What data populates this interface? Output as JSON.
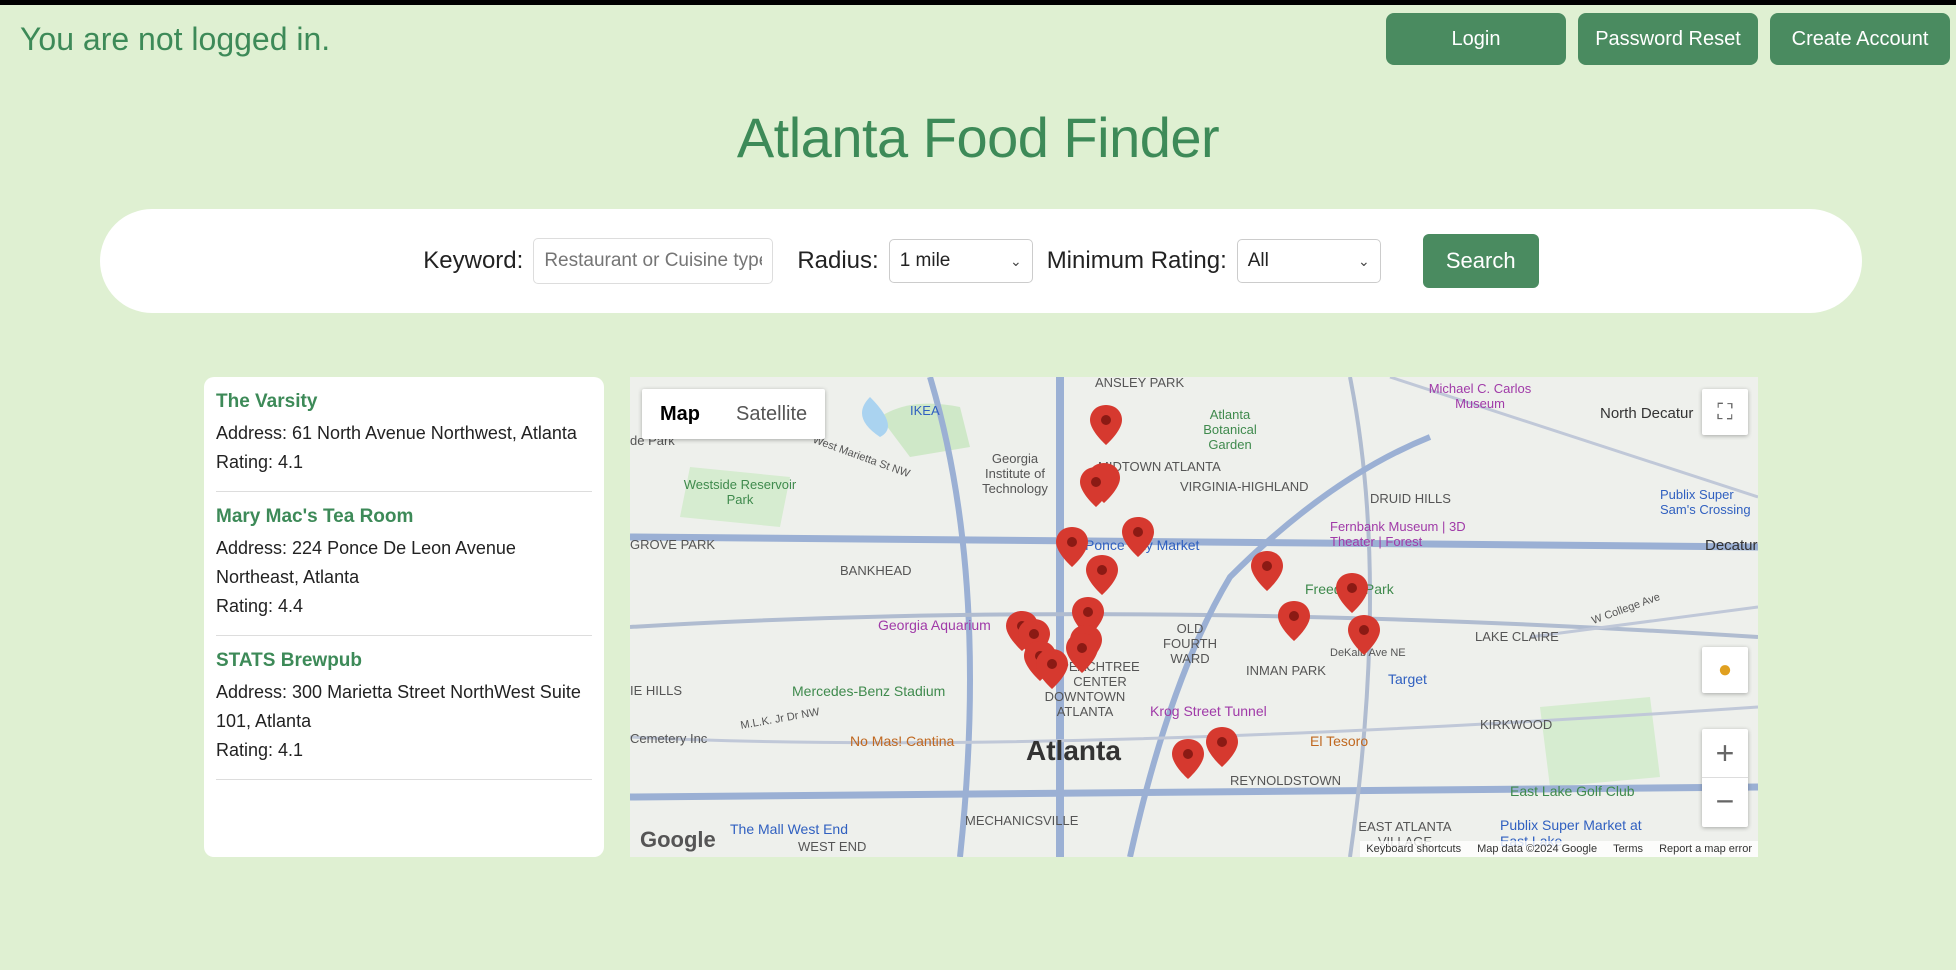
{
  "status": "You are not logged in.",
  "auth": {
    "login": "Login",
    "reset": "Password Reset",
    "create": "Create Account"
  },
  "title": "Atlanta Food Finder",
  "search": {
    "keyword_label": "Keyword:",
    "keyword_placeholder": "Restaurant or Cuisine type",
    "radius_label": "Radius:",
    "radius_value": "1 mile",
    "rating_label": "Minimum Rating:",
    "rating_value": "All",
    "button": "Search"
  },
  "results": [
    {
      "name": "The Varsity",
      "address": "Address: 61 North Avenue Northwest, Atlanta",
      "rating": "Rating: 4.1"
    },
    {
      "name": "Mary Mac's Tea Room",
      "address": "Address: 224 Ponce De Leon Avenue Northeast, Atlanta",
      "rating": "Rating: 4.4"
    },
    {
      "name": "STATS Brewpub",
      "address": "Address: 300 Marietta Street NorthWest Suite 101, Atlanta",
      "rating": "Rating: 4.1"
    }
  ],
  "map": {
    "type_map": "Map",
    "type_satellite": "Satellite",
    "city_label": "Atlanta",
    "google": "Google",
    "attribution": [
      "Keyboard shortcuts",
      "Map data ©2024 Google",
      "Terms",
      "Report a map error"
    ],
    "labels": [
      "ANSLEY PARK",
      "Atlanta Botanical Garden",
      "Michael C. Carlos Museum",
      "North Decatur",
      "IKEA",
      "Georgia Institute of Technology",
      "MIDTOWN ATLANTA",
      "VIRGINIA-HIGHLAND",
      "DRUID HILLS",
      "Westside Reservoir Park",
      "Publix Super Sam's Crossing",
      "Fernbank Museum | 3D Theater | Forest",
      "GROVE PARK",
      "Ponce City Market",
      "Decatur",
      "BANKHEAD",
      "Freedom Park",
      "Georgia Aquarium",
      "OLD FOURTH WARD",
      "LAKE CLAIRE",
      "PEACHTREE CENTER",
      "INMAN PARK",
      "Target",
      "Mercedes-Benz Stadium",
      "DOWNTOWN ATLANTA",
      "Krog Street Tunnel",
      "KIRKWOOD",
      "Cemetery Inc",
      "No Mas! Cantina",
      "El Tesoro",
      "REYNOLDSTOWN",
      "East Lake Golf Club",
      "The Mall West End",
      "MECHANICSVILLE",
      "EAST ATLANTA VILLAGE",
      "Publix Super Market at East Lake",
      "WEST END",
      "de Park",
      "West Marietta St NW",
      "M.L.K. Jr Dr NW",
      "DeKalb Ave NE",
      "W College Ave",
      "IE HILLS"
    ]
  },
  "colors": {
    "bg": "#dff0d2",
    "accent": "#4a8b60",
    "title": "#3d8a58",
    "marker": "#d6392f"
  }
}
